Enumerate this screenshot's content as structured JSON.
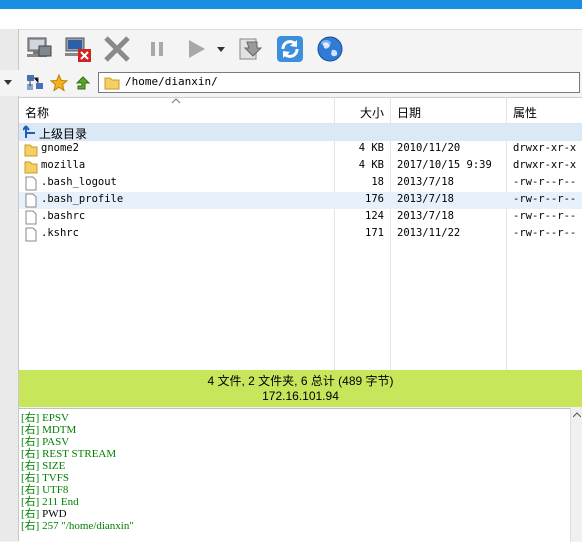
{
  "toolbar": {
    "icons": [
      "connect-icon",
      "disconnect-icon",
      "cancel-icon",
      "pause-icon",
      "play-icon",
      "dropdown-icon",
      "queue-icon",
      "refresh-icon",
      "globe-icon"
    ]
  },
  "address": {
    "path": "/home/dianxin/"
  },
  "file_list": {
    "columns": [
      "名称",
      "大小",
      "日期",
      "属性"
    ],
    "parent_label": "上级目录",
    "rows": [
      {
        "name": "gnome2",
        "size": "4 KB",
        "date": "2010/11/20",
        "perm": "drwxr-xr-x",
        "type": "folder"
      },
      {
        "name": "mozilla",
        "size": "4 KB",
        "date": "2017/10/15 9:39",
        "perm": "drwxr-xr-x",
        "type": "folder"
      },
      {
        "name": ".bash_logout",
        "size": "18",
        "date": "2013/7/18",
        "perm": "-rw-r--r--",
        "type": "file"
      },
      {
        "name": ".bash_profile",
        "size": "176",
        "date": "2013/7/18",
        "perm": "-rw-r--r--",
        "type": "file"
      },
      {
        "name": ".bashrc",
        "size": "124",
        "date": "2013/7/18",
        "perm": "-rw-r--r--",
        "type": "file"
      },
      {
        "name": ".kshrc",
        "size": "171",
        "date": "2013/11/22",
        "perm": "-rw-r--r--",
        "type": "file"
      }
    ]
  },
  "status": {
    "summary": "4 文件, 2 文件夹, 6 总计 (489 字节)",
    "host": "172.16.101.94",
    "color": "#c7e65c"
  },
  "log": {
    "lines": [
      {
        "tag": "[右]",
        "text": "  EPSV",
        "color": "#008000"
      },
      {
        "tag": "[右]",
        "text": "  MDTM",
        "color": "#008000"
      },
      {
        "tag": "[右]",
        "text": "  PASV",
        "color": "#008000"
      },
      {
        "tag": "[右]",
        "text": "  REST STREAM",
        "color": "#008000"
      },
      {
        "tag": "[右]",
        "text": "  SIZE",
        "color": "#008000"
      },
      {
        "tag": "[右]",
        "text": "  TVFS",
        "color": "#008000"
      },
      {
        "tag": "[右]",
        "text": "  UTF8",
        "color": "#008000"
      },
      {
        "tag": "[右]",
        "text": " 211 End",
        "color": "#008000"
      },
      {
        "tag": "[右]",
        "text": " PWD",
        "color": "#000000"
      },
      {
        "tag": "[右]",
        "text": " 257 \"/home/dianxin\"",
        "color": "#008000"
      }
    ]
  }
}
